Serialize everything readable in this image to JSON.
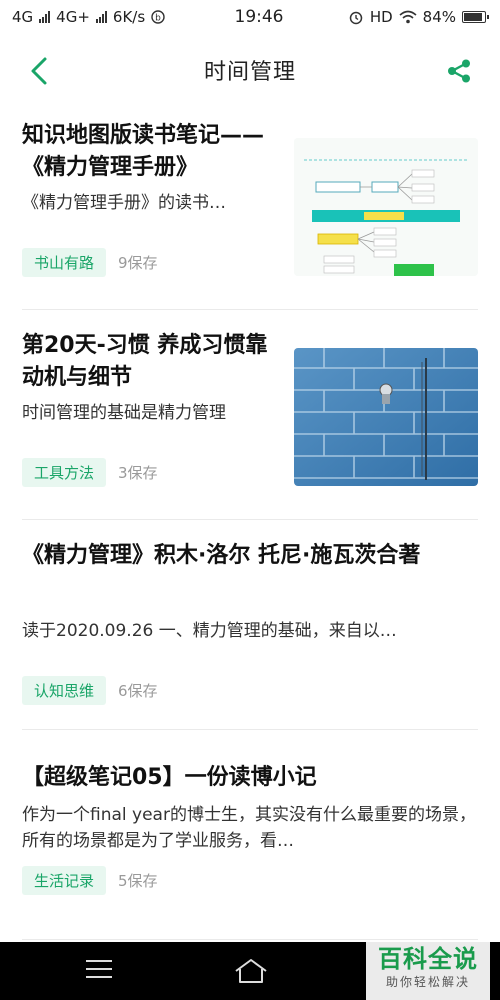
{
  "status_bar": {
    "network1": "4G",
    "network2": "4G+",
    "speed": "6K/s",
    "time": "19:46",
    "hd": "HD",
    "battery": "84%"
  },
  "header": {
    "title": "时间管理",
    "back_icon": "chevron-left-icon",
    "share_icon": "share-icon",
    "accent_color": "#1aa568"
  },
  "articles": [
    {
      "title": "知识地图版读书笔记——《精力管理手册》",
      "excerpt": "《精力管理手册》的读书…",
      "tag": "书山有路",
      "saves": "9保存",
      "thumbnail": "mind-map-image"
    },
    {
      "title": "第20天-习惯 养成习惯靠动机与细节",
      "excerpt": "时间管理的基础是精力管理",
      "tag": "工具方法",
      "saves": "3保存",
      "thumbnail": "blue-tile-shower-image"
    },
    {
      "title": "《精力管理》积木·洛尔 托尼·施瓦茨合著",
      "excerpt": "读于2020.09.26 一、精力管理的基础，来自以…",
      "tag": "认知思维",
      "saves": "6保存"
    },
    {
      "title": "【超级笔记05】一份读博小记",
      "excerpt": "作为一个final year的博士生，其实没有什么最重要的场景，所有的场景都是为了学业服务，看…",
      "tag": "生活记录",
      "saves": "5保存"
    }
  ],
  "nav": {
    "menu_icon": "menu-icon",
    "home_icon": "home-icon"
  },
  "watermark": {
    "title": "百科全说",
    "subtitle": "助你轻松解决"
  }
}
